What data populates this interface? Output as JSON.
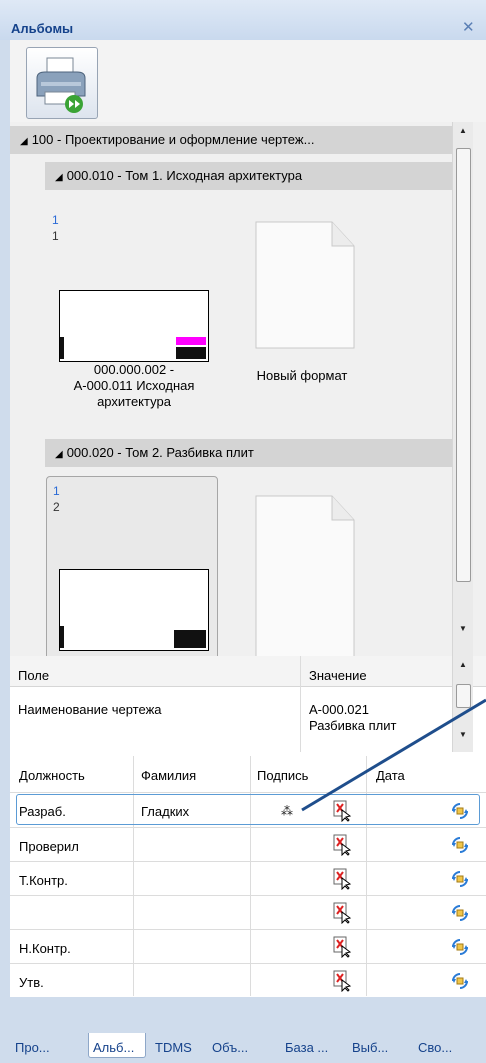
{
  "panel": {
    "title": "Альбомы",
    "close_glyph": "✕"
  },
  "toolbar": {
    "print_icon": "printer-forward-icon"
  },
  "tree": {
    "root": {
      "label": "100 - Проектирование  и оформление чертеж..."
    },
    "albums": [
      {
        "label": "000.010 - Том 1. Исходная архитектура",
        "sheets": [
          {
            "num": "1",
            "sub": "1",
            "caption_lines": [
              "000.000.002 -",
              "А-000.011 Исходная",
              "архитектура"
            ]
          },
          {
            "caption_lines": [
              "Новый формат"
            ]
          }
        ]
      },
      {
        "label": "000.020 - Том 2. Разбивка плит",
        "sheets": [
          {
            "num": "1",
            "sub": "2"
          }
        ]
      }
    ]
  },
  "properties": {
    "headers": [
      "Поле",
      "Значение"
    ],
    "rows": [
      {
        "field": "Наименование чертежа",
        "value_lines": [
          "А-000.021",
          "Разбивка плит"
        ]
      }
    ]
  },
  "signatures": {
    "headers": [
      "Должность",
      "Фамилия",
      "Подпись",
      "Дата"
    ],
    "rows": [
      {
        "role": "Разраб.",
        "name": "Гладких"
      },
      {
        "role": "Проверил",
        "name": ""
      },
      {
        "role": "Т.Контр.",
        "name": ""
      },
      {
        "role": "",
        "name": ""
      },
      {
        "role": "Н.Контр.",
        "name": ""
      },
      {
        "role": "Утв.",
        "name": ""
      }
    ]
  },
  "tabs": [
    {
      "label": "Про..."
    },
    {
      "label": "Альб..."
    },
    {
      "label": "TDMS"
    },
    {
      "label": "Объ..."
    },
    {
      "label": "База ..."
    },
    {
      "label": "Выб..."
    },
    {
      "label": "Сво..."
    }
  ],
  "colors": {
    "accent": "#15428b",
    "selection": "#5b9bd5",
    "drawing_highlight": "#ff00ff"
  }
}
